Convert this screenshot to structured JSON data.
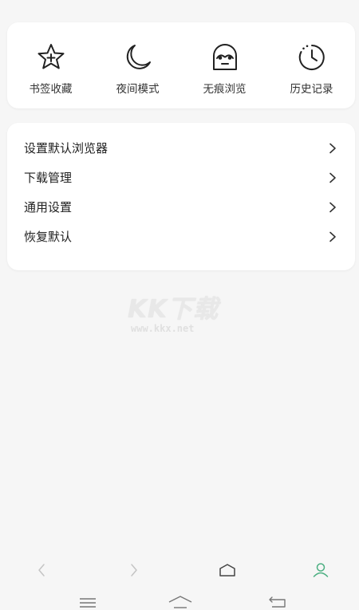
{
  "quick_actions": [
    {
      "label": "书签收藏",
      "icon": "star-plus-icon"
    },
    {
      "label": "夜间模式",
      "icon": "moon-icon"
    },
    {
      "label": "无痕浏览",
      "icon": "ghost-icon"
    },
    {
      "label": "历史记录",
      "icon": "clock-history-icon"
    }
  ],
  "menu": {
    "items": [
      {
        "label": "设置默认浏览器"
      },
      {
        "label": "下载管理"
      },
      {
        "label": "通用设置"
      },
      {
        "label": "恢复默认"
      }
    ]
  },
  "watermark": {
    "brand": "KK下载",
    "url": "www.kkx.net"
  },
  "colors": {
    "background": "#f6f6f6",
    "card": "#ffffff",
    "profile_accent": "#4caf82"
  }
}
